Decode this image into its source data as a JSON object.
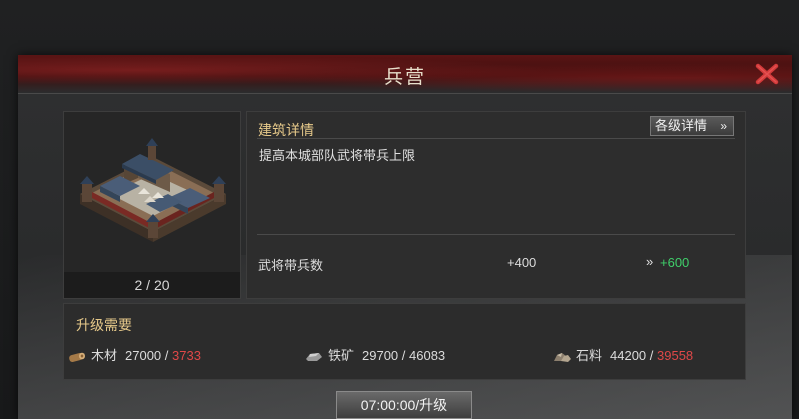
{
  "dialog": {
    "title": "兵营",
    "close_icon": "close-icon"
  },
  "building": {
    "image_icon": "barracks-building-icon",
    "level_text": "2 / 20"
  },
  "details": {
    "section_title": "建筑详情",
    "level_details_button": "各级详情",
    "level_details_chevron": "»",
    "description": "提高本城部队武将带兵上限",
    "stat_label": "武将带兵数",
    "stat_current": "+400",
    "stat_next_arrow": "»",
    "stat_next": "+600"
  },
  "upgrade": {
    "section_title": "升级需要",
    "resources": [
      {
        "icon": "wood-icon",
        "label": "木材",
        "required": "27000",
        "separator": " / ",
        "owned": "3733",
        "sufficient": false
      },
      {
        "icon": "iron-icon",
        "label": "铁矿",
        "required": "29700",
        "separator": " / ",
        "owned": "46083",
        "sufficient": true
      },
      {
        "icon": "stone-icon",
        "label": "石料",
        "required": "44200",
        "separator": " / ",
        "owned": "39558",
        "sufficient": false
      }
    ],
    "button_label": "07:00:00/升级"
  },
  "colors": {
    "accent_gold": "#e6c98a",
    "insufficient_red": "#e04848",
    "increase_green": "#3fcf6a",
    "close_red": "#d23a3a"
  }
}
